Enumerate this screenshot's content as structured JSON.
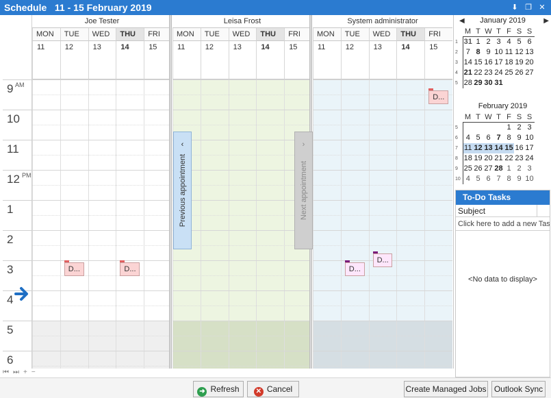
{
  "window": {
    "title": "Schedule   11 - 15 February 2019"
  },
  "times": [
    {
      "hour": "9",
      "ampm": "AM"
    },
    {
      "hour": "10",
      "ampm": ""
    },
    {
      "hour": "11",
      "ampm": ""
    },
    {
      "hour": "12",
      "ampm": "PM"
    },
    {
      "hour": "1",
      "ampm": ""
    },
    {
      "hour": "2",
      "ampm": ""
    },
    {
      "hour": "3",
      "ampm": ""
    },
    {
      "hour": "4",
      "ampm": ""
    },
    {
      "hour": "5",
      "ampm": ""
    },
    {
      "hour": "6",
      "ampm": ""
    }
  ],
  "days": [
    {
      "name": "MON",
      "date": "11"
    },
    {
      "name": "TUE",
      "date": "12"
    },
    {
      "name": "WED",
      "date": "13"
    },
    {
      "name": "THU",
      "date": "14"
    },
    {
      "name": "FRI",
      "date": "15"
    }
  ],
  "resources": [
    {
      "name": "Joe Tester",
      "color": "#ffffff"
    },
    {
      "name": "Leisa Frost",
      "color": "#edf5e1"
    },
    {
      "name": "System administrator",
      "color": "#eaf4f9"
    }
  ],
  "appointments": [
    {
      "label": "D...",
      "resource": 0,
      "day": 1,
      "slot": 6.0,
      "bg": "#fbd4d4",
      "bar": "#e06060"
    },
    {
      "label": "D...",
      "resource": 0,
      "day": 3,
      "slot": 6.0,
      "bg": "#fbd4d4",
      "bar": "#e06060"
    },
    {
      "label": "D...",
      "resource": 2,
      "day": 4,
      "slot": 0.3,
      "bg": "#fbd4d4",
      "bar": "#e06060"
    },
    {
      "label": "D...",
      "resource": 2,
      "day": 1,
      "slot": 6.0,
      "bg": "#fde6fb",
      "bar": "#7a1a7a"
    },
    {
      "label": "D...",
      "resource": 2,
      "day": 2,
      "slot": 5.7,
      "bg": "#fde6fb",
      "bar": "#7a1a7a"
    }
  ],
  "nav": {
    "previous": "Previous appointment",
    "next": "Next appointment"
  },
  "buttons": {
    "refresh": "Refresh",
    "cancel": "Cancel",
    "create_jobs": "Create Managed Jobs",
    "outlook_sync": "Outlook Sync"
  },
  "calendars": [
    {
      "title": "January 2019",
      "weekdays": [
        "M",
        "T",
        "W",
        "T",
        "F",
        "S",
        "S"
      ],
      "weeks": [
        {
          "wk": "1",
          "days": [
            [
              "31",
              "other bold"
            ],
            [
              "1",
              ""
            ],
            [
              "2",
              ""
            ],
            [
              "3",
              ""
            ],
            [
              "4",
              ""
            ],
            [
              "5",
              ""
            ],
            [
              "6",
              ""
            ]
          ]
        },
        {
          "wk": "2",
          "days": [
            [
              "7",
              ""
            ],
            [
              "8",
              "bold"
            ],
            [
              "9",
              ""
            ],
            [
              "10",
              ""
            ],
            [
              "11",
              ""
            ],
            [
              "12",
              ""
            ],
            [
              "13",
              ""
            ]
          ]
        },
        {
          "wk": "3",
          "days": [
            [
              "14",
              ""
            ],
            [
              "15",
              ""
            ],
            [
              "16",
              ""
            ],
            [
              "17",
              ""
            ],
            [
              "18",
              ""
            ],
            [
              "19",
              ""
            ],
            [
              "20",
              ""
            ]
          ]
        },
        {
          "wk": "4",
          "days": [
            [
              "21",
              "bold"
            ],
            [
              "22",
              ""
            ],
            [
              "23",
              ""
            ],
            [
              "24",
              ""
            ],
            [
              "25",
              ""
            ],
            [
              "26",
              ""
            ],
            [
              "27",
              ""
            ]
          ]
        },
        {
          "wk": "5",
          "days": [
            [
              "28",
              ""
            ],
            [
              "29",
              "bold"
            ],
            [
              "30",
              "bold"
            ],
            [
              "31",
              "bold"
            ],
            [
              "",
              ""
            ],
            [
              "",
              ""
            ],
            [
              "",
              ""
            ]
          ]
        }
      ]
    },
    {
      "title": "February 2019",
      "weekdays": [
        "M",
        "T",
        "W",
        "T",
        "F",
        "S",
        "S"
      ],
      "weeks": [
        {
          "wk": "5",
          "days": [
            [
              "",
              ""
            ],
            [
              "",
              ""
            ],
            [
              "",
              ""
            ],
            [
              "",
              ""
            ],
            [
              "1",
              ""
            ],
            [
              "2",
              ""
            ],
            [
              "3",
              ""
            ]
          ]
        },
        {
          "wk": "6",
          "days": [
            [
              "4",
              ""
            ],
            [
              "5",
              ""
            ],
            [
              "6",
              ""
            ],
            [
              "7",
              "bold"
            ],
            [
              "8",
              ""
            ],
            [
              "9",
              ""
            ],
            [
              "10",
              ""
            ]
          ]
        },
        {
          "wk": "7",
          "days": [
            [
              "11",
              "sel"
            ],
            [
              "12",
              "sel bold"
            ],
            [
              "13",
              "sel bold"
            ],
            [
              "14",
              "sel bold"
            ],
            [
              "15",
              "sel bold"
            ],
            [
              "16",
              ""
            ],
            [
              "17",
              ""
            ]
          ]
        },
        {
          "wk": "8",
          "days": [
            [
              "18",
              ""
            ],
            [
              "19",
              ""
            ],
            [
              "20",
              ""
            ],
            [
              "21",
              ""
            ],
            [
              "22",
              ""
            ],
            [
              "23",
              ""
            ],
            [
              "24",
              ""
            ]
          ]
        },
        {
          "wk": "9",
          "days": [
            [
              "25",
              ""
            ],
            [
              "26",
              ""
            ],
            [
              "27",
              ""
            ],
            [
              "28",
              "bold"
            ],
            [
              "1",
              "other"
            ],
            [
              "2",
              "other"
            ],
            [
              "3",
              "other"
            ]
          ]
        },
        {
          "wk": "10",
          "days": [
            [
              "4",
              "other"
            ],
            [
              "5",
              "other"
            ],
            [
              "6",
              "other"
            ],
            [
              "7",
              "other"
            ],
            [
              "8",
              "other"
            ],
            [
              "9",
              "other"
            ],
            [
              "10",
              "other"
            ]
          ]
        }
      ]
    }
  ],
  "todo": {
    "title": "To-Do Tasks",
    "column": "Subject",
    "add_placeholder": "Click here to add a new Task",
    "empty": "<No data to display>"
  },
  "icons": {
    "current_time": "arrow-right-icon",
    "pin": "pin-icon",
    "restore": "restore-icon",
    "close": "close-icon"
  }
}
